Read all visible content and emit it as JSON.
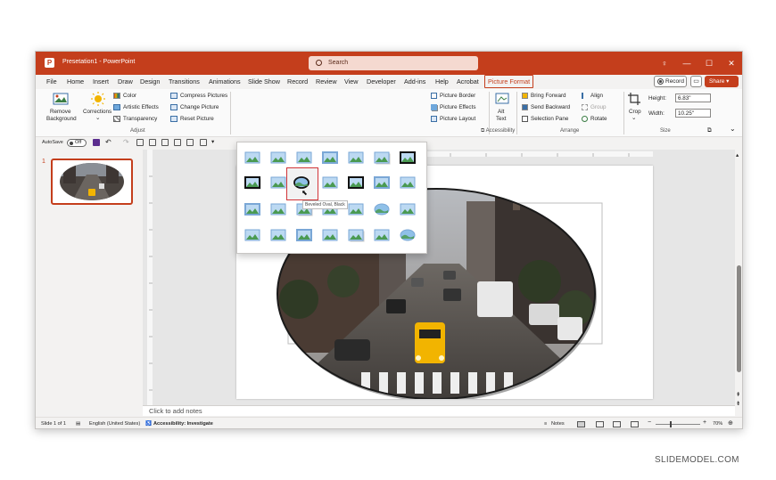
{
  "window": {
    "app_title": "Presetation1 - PowerPoint",
    "search_placeholder": "Search",
    "title_buttons": {
      "lightbulb": "♀",
      "minimize": "—",
      "maximize": "☐",
      "close": "✕"
    }
  },
  "tabs": [
    "File",
    "Home",
    "Insert",
    "Draw",
    "Design",
    "Transitions",
    "Animations",
    "Slide Show",
    "Record",
    "Review",
    "View",
    "Developer",
    "Add-ins",
    "Help",
    "Acrobat",
    "Picture Format"
  ],
  "active_tab": "Picture Format",
  "actions": {
    "record": "Record",
    "share": "Share"
  },
  "ribbon": {
    "adjust": {
      "remove_bg_line1": "Remove",
      "remove_bg_line2": "Background",
      "corrections": "Corrections",
      "color": "Color",
      "artistic": "Artistic Effects",
      "transparency": "Transparency",
      "compress": "Compress Pictures",
      "change": "Change Picture",
      "reset": "Reset Picture",
      "group_label": "Adjust"
    },
    "styles": {
      "border": "Picture Border",
      "effects": "Picture Effects",
      "layout": "Picture Layout"
    },
    "accessibility": {
      "alt_line1": "Alt",
      "alt_line2": "Text",
      "group_label": "Accessibility"
    },
    "arrange": {
      "bring": "Bring Forward",
      "send": "Send Backward",
      "pane": "Selection Pane",
      "align": "Align",
      "group": "Group",
      "rotate": "Rotate",
      "group_label": "Arrange"
    },
    "size": {
      "crop": "Crop",
      "height_label": "Height:",
      "height_value": "6.83\"",
      "width_label": "Width:",
      "width_value": "10.25\"",
      "group_label": "Size"
    }
  },
  "qat": {
    "autosave": "AutoSave",
    "autosave_state": "Off"
  },
  "gallery": {
    "tooltip": "Beveled Oval, Black",
    "selected_index": 9,
    "rows": 4,
    "cols": 7
  },
  "thumbnail": {
    "number": "1"
  },
  "notes": {
    "placeholder": "Click to add notes"
  },
  "status": {
    "slide": "Slide 1 of 1",
    "language": "English (United States)",
    "accessibility": "Accessibility: Investigate",
    "notes": "Notes",
    "zoom": "70%"
  },
  "watermark": "SLIDEMODEL.COM",
  "colors": {
    "accent": "#c43e1c",
    "selection": "#d13438"
  }
}
